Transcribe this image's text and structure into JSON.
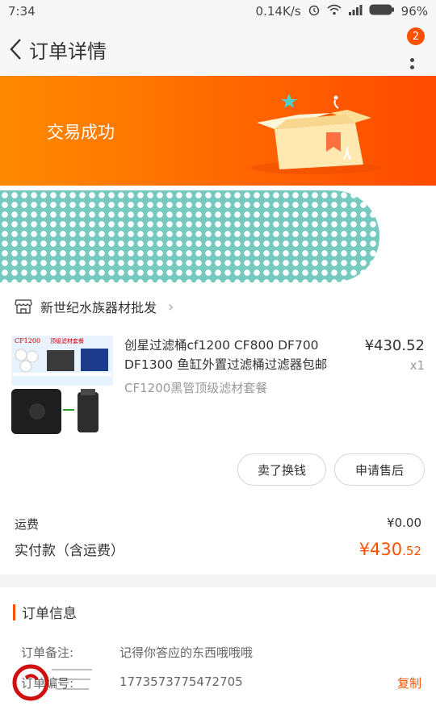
{
  "status_bar": {
    "time": "7:34",
    "network_speed": "0.14K/s",
    "battery": "96%"
  },
  "nav": {
    "title": "订单详情",
    "badge_count": "2"
  },
  "banner": {
    "status_text": "交易成功"
  },
  "shop": {
    "name": "新世纪水族器材批发"
  },
  "product": {
    "title": "创星过滤桶cf1200 CF800 DF700 DF1300 鱼缸外置过滤桶过滤器包邮",
    "price": "¥430.52",
    "quantity": "x1",
    "spec": "CF1200黑管顶级滤材套餐",
    "thumb_label": "CF1200",
    "thumb_caption": "顶级滤材套餐"
  },
  "actions": {
    "sell_label": "卖了换钱",
    "after_sale_label": "申请售后"
  },
  "fees": {
    "shipping_label": "运费",
    "shipping_value": "¥0.00",
    "total_label": "实付款（含运费）",
    "total_int": "¥430",
    "total_dec": ".52"
  },
  "order_info": {
    "title": "订单信息",
    "rows": [
      {
        "key": "订单备注:",
        "value": "记得你答应的东西哦哦哦"
      },
      {
        "key": "订单编号:",
        "value": "1773573775472705"
      }
    ],
    "copy_label": "复制"
  },
  "colors": {
    "accent": "#ff5000",
    "banner_start": "#ff8a00",
    "banner_end": "#ff4a00",
    "mask": "#6fc8bd"
  }
}
